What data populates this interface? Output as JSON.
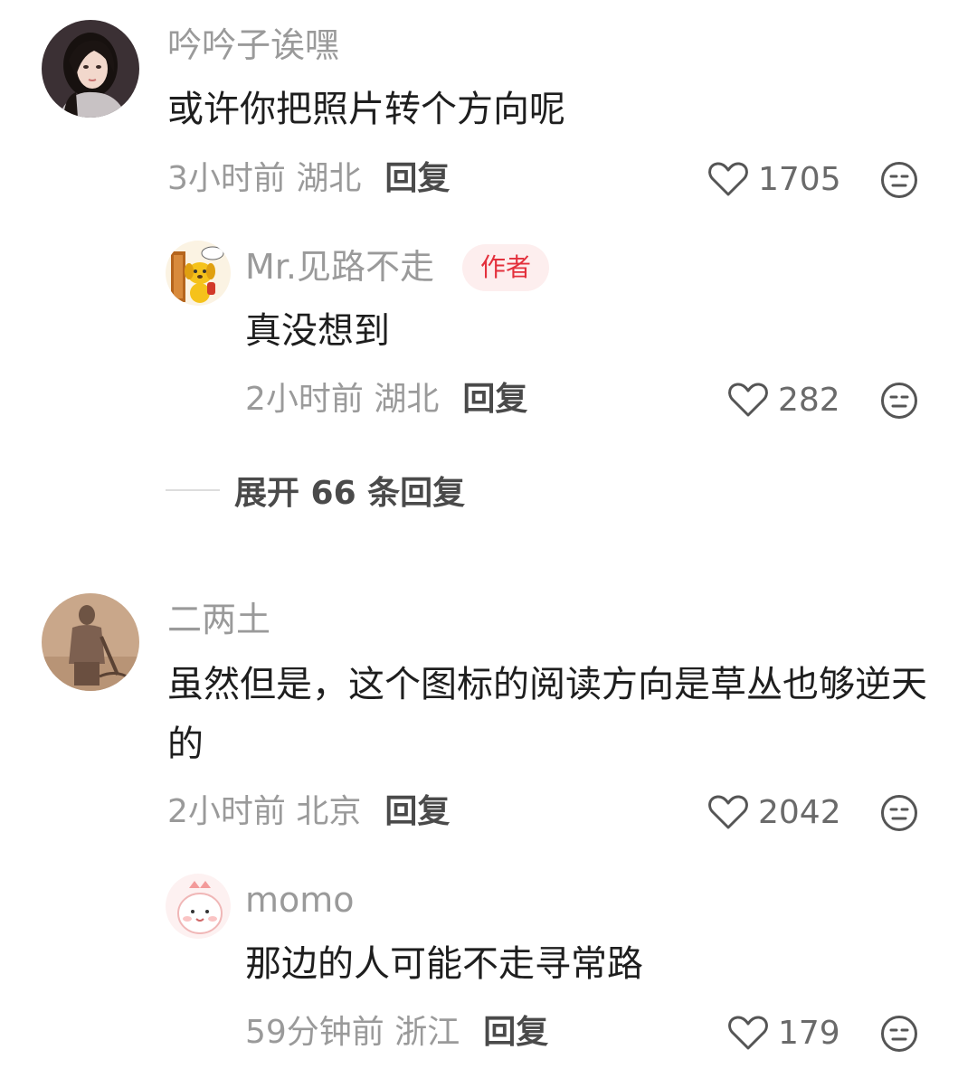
{
  "comments": [
    {
      "user": "吟吟子诶嘿",
      "text": "或许你把照片转个方向呢",
      "time_location": "3小时前 湖北",
      "reply_label": "回复",
      "likes": "1705",
      "avatar_icon": "portrait-woman",
      "replies": [
        {
          "user": "Mr.见路不走",
          "badge": "作者",
          "text": "真没想到",
          "time_location": "2小时前 湖北",
          "reply_label": "回复",
          "likes": "282",
          "avatar_icon": "cartoon-dog"
        }
      ],
      "expand_label": "展开 66 条回复"
    },
    {
      "user": "二两土",
      "text": "虽然但是，这个图标的阅读方向是草丛也够逆天的",
      "time_location": "2小时前 北京",
      "reply_label": "回复",
      "likes": "2042",
      "avatar_icon": "terracotta-statue",
      "replies": [
        {
          "user": "momo",
          "text": "那边的人可能不走寻常路",
          "time_location": "59分钟前 浙江",
          "reply_label": "回复",
          "likes": "179",
          "avatar_icon": "cartoon-dinosaur"
        }
      ]
    }
  ],
  "colors": {
    "username": "#9a9a9a",
    "body_text": "#1e1e1e",
    "badge_bg": "#fdeeee",
    "badge_text": "#e3303c"
  }
}
